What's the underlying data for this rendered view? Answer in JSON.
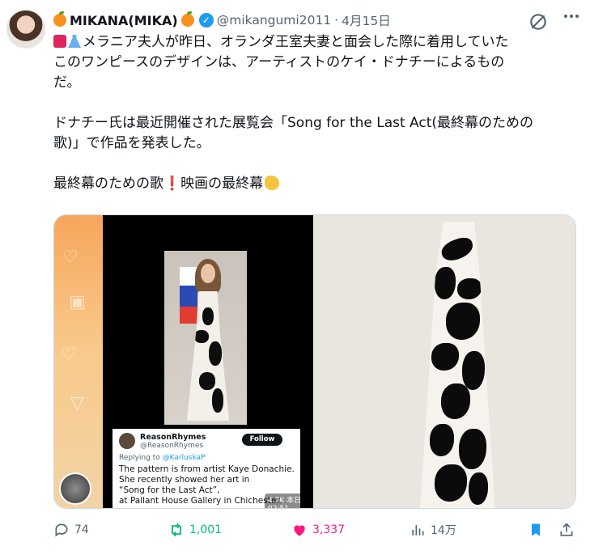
{
  "post": {
    "display_name": "MIKANA(MIKA)",
    "handle": "@mikangumi2011",
    "separator": "·",
    "date": "4月15日",
    "lines": [
      "メラニア夫人が昨日、オランダ王室夫妻と面会した際に着用していた",
      "このワンピースのデザインは、アーティストのケイ・ドナチーによるもの",
      "だ。",
      "",
      "ドナチー氏は最近開催された展覧会「Song for the Last Act(最終幕のための",
      "歌)」で作品を発表した。",
      "",
      "最終幕のための歌",
      "映画の最終幕"
    ]
  },
  "embedded_tweet": {
    "name": "ReasonRhymes",
    "handle": "@ReasonRhymes",
    "follow_label": "Follow",
    "replying_prefix": "Replying to ",
    "replying_to": "@KarluskaP",
    "body": [
      "The pattern is from artist Kaye Donachie.",
      "She recently showed her art in",
      "“Song for the Last Act”,",
      "at Pallant House Gallery in Chichester."
    ],
    "views": "4.7K 本日 02:51"
  },
  "actions": {
    "replies": "74",
    "reposts": "1,001",
    "likes": "3,337",
    "views": "14万"
  },
  "icons": {
    "verified": "verified-badge-icon",
    "grok": "grok-icon",
    "more": "more-options-icon",
    "reply": "reply-icon",
    "repost": "repost-icon",
    "like": "heart-icon",
    "views": "views-chart-icon",
    "bookmark": "bookmark-icon",
    "share": "share-icon"
  },
  "colors": {
    "verified": "#1d9bf0",
    "repost": "#00ba7c",
    "like": "#f91880",
    "bookmark": "#1d9bf0",
    "secondary_text": "#536471"
  }
}
